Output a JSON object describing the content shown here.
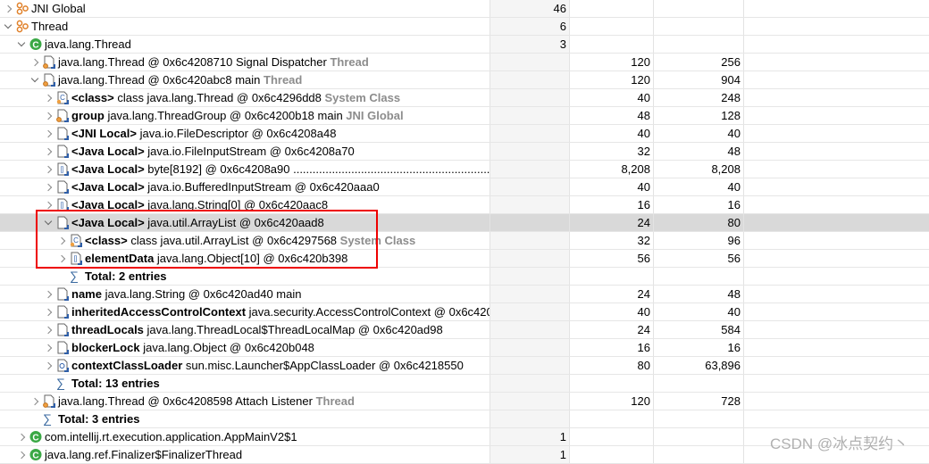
{
  "columns": {
    "name": "",
    "objects": "",
    "shallow": "",
    "retained": ""
  },
  "rows": [
    {
      "level": 0,
      "toggle": "collapsed",
      "icon": "group-icon",
      "text": "JNI Global",
      "objects": "46"
    },
    {
      "level": 0,
      "toggle": "expanded",
      "icon": "group-icon",
      "text": "Thread",
      "objects": "6"
    },
    {
      "level": 1,
      "toggle": "expanded",
      "icon": "class-icon",
      "text": "java.lang.Thread",
      "objects": "3"
    },
    {
      "level": 2,
      "toggle": "collapsed",
      "icon": "thread-object-icon",
      "text": "java.lang.Thread @ 0x6c4208710  Signal Dispatcher",
      "suffix": "Thread",
      "shallow": "120",
      "retained": "256"
    },
    {
      "level": 2,
      "toggle": "expanded",
      "icon": "thread-object-icon",
      "text": "java.lang.Thread @ 0x6c420abc8  main",
      "suffix": "Thread",
      "shallow": "120",
      "retained": "904"
    },
    {
      "level": 3,
      "toggle": "collapsed",
      "icon": "class-object-icon",
      "field": "<class>",
      "text": "class java.lang.Thread @ 0x6c4296dd8",
      "suffix": "System Class",
      "shallow": "40",
      "retained": "248"
    },
    {
      "level": 3,
      "toggle": "collapsed",
      "icon": "gc-root-object-icon",
      "field": "group",
      "text": "java.lang.ThreadGroup @ 0x6c4200b18  main",
      "suffix": "JNI Global",
      "shallow": "48",
      "retained": "128"
    },
    {
      "level": 3,
      "toggle": "collapsed",
      "icon": "object-icon",
      "field": "<JNI Local>",
      "text": "java.io.FileDescriptor @ 0x6c4208a48",
      "shallow": "40",
      "retained": "40"
    },
    {
      "level": 3,
      "toggle": "collapsed",
      "icon": "object-icon",
      "field": "<Java Local>",
      "text": "java.io.FileInputStream @ 0x6c4208a70",
      "shallow": "32",
      "retained": "48"
    },
    {
      "level": 3,
      "toggle": "collapsed",
      "icon": "array-icon",
      "field": "<Java Local>",
      "text": "byte[8192] @ 0x6c4208a90  ........................................................................................",
      "shallow": "8,208",
      "retained": "8,208"
    },
    {
      "level": 3,
      "toggle": "collapsed",
      "icon": "object-icon",
      "field": "<Java Local>",
      "text": "java.io.BufferedInputStream @ 0x6c420aaa0",
      "shallow": "40",
      "retained": "40"
    },
    {
      "level": 3,
      "toggle": "collapsed",
      "icon": "array-icon",
      "field": "<Java Local>",
      "text": "java.lang.String[0] @ 0x6c420aac8",
      "shallow": "16",
      "retained": "16"
    },
    {
      "level": 3,
      "toggle": "expanded",
      "icon": "object-icon",
      "field": "<Java Local>",
      "text": "java.util.ArrayList @ 0x6c420aad8",
      "shallow": "24",
      "retained": "80",
      "selected": true
    },
    {
      "level": 4,
      "toggle": "collapsed",
      "icon": "class-object-icon",
      "field": "<class>",
      "text": "class java.util.ArrayList @ 0x6c4297568",
      "suffix": "System Class",
      "shallow": "32",
      "retained": "96"
    },
    {
      "level": 4,
      "toggle": "collapsed",
      "icon": "array-icon",
      "field": "elementData",
      "text": "java.lang.Object[10] @ 0x6c420b398",
      "shallow": "56",
      "retained": "56"
    },
    {
      "level": 4,
      "toggle": "none",
      "icon": "sigma-icon",
      "total": "Total: 2 entries"
    },
    {
      "level": 3,
      "toggle": "collapsed",
      "icon": "object-icon",
      "field": "name",
      "text": "java.lang.String @ 0x6c420ad40  main",
      "shallow": "24",
      "retained": "48"
    },
    {
      "level": 3,
      "toggle": "collapsed",
      "icon": "object-icon",
      "field": "inheritedAccessControlContext",
      "text": "java.security.AccessControlContext @ 0x6c420",
      "shallow": "40",
      "retained": "40"
    },
    {
      "level": 3,
      "toggle": "collapsed",
      "icon": "object-icon",
      "field": "threadLocals",
      "text": "java.lang.ThreadLocal$ThreadLocalMap @ 0x6c420ad98",
      "shallow": "24",
      "retained": "584"
    },
    {
      "level": 3,
      "toggle": "collapsed",
      "icon": "object-icon",
      "field": "blockerLock",
      "text": "java.lang.Object @ 0x6c420b048",
      "shallow": "16",
      "retained": "16"
    },
    {
      "level": 3,
      "toggle": "collapsed",
      "icon": "classloader-icon",
      "field": "contextClassLoader",
      "text": "sun.misc.Launcher$AppClassLoader @ 0x6c4218550",
      "shallow": "80",
      "retained": "63,896"
    },
    {
      "level": 3,
      "toggle": "none",
      "icon": "sigma-icon",
      "total": "Total: 13 entries"
    },
    {
      "level": 2,
      "toggle": "collapsed",
      "icon": "thread-object-icon",
      "text": "java.lang.Thread @ 0x6c4208598  Attach Listener",
      "suffix": "Thread",
      "shallow": "120",
      "retained": "728"
    },
    {
      "level": 2,
      "toggle": "none",
      "icon": "sigma-icon",
      "total": "Total: 3 entries"
    },
    {
      "level": 1,
      "toggle": "collapsed",
      "icon": "class-icon",
      "text": "com.intellij.rt.execution.application.AppMainV2$1",
      "objects": "1"
    },
    {
      "level": 1,
      "toggle": "collapsed",
      "icon": "class-icon",
      "text": "java.lang.ref.Finalizer$FinalizerThread",
      "objects": "1"
    }
  ],
  "colors": {
    "selection": "#d9d9d9",
    "highlight_box": "#e00000",
    "class_icon": "#3aa845",
    "group_icon": "#e8912d",
    "suffix_gray": "#8c8c8c"
  },
  "watermark": "CSDN @冰点契约丶"
}
